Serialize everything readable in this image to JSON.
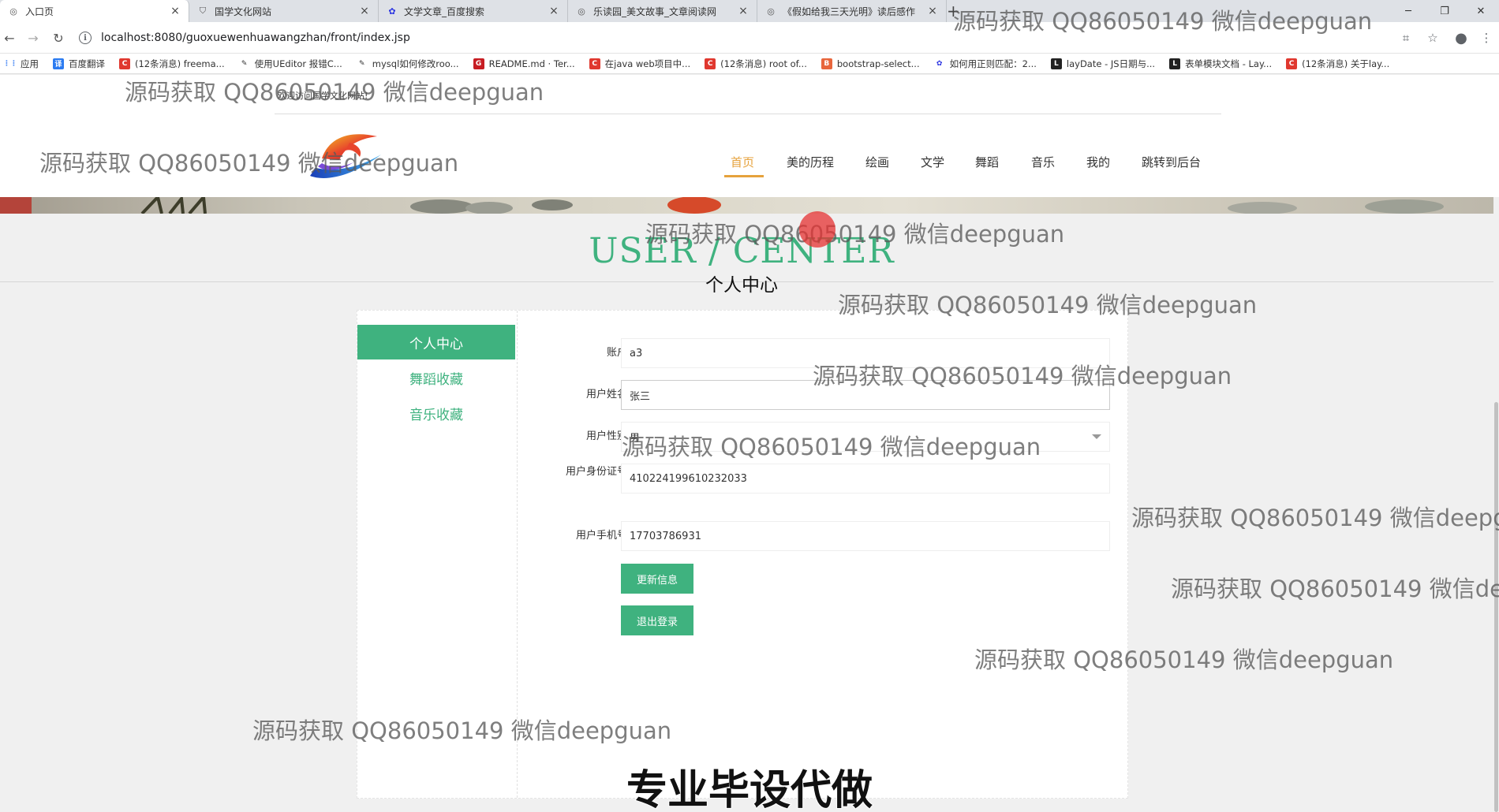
{
  "browser": {
    "tabs": [
      {
        "title": "入口页",
        "icon": "globe-icon",
        "active": true
      },
      {
        "title": "国学文化网站",
        "icon": "shield-icon",
        "active": false
      },
      {
        "title": "文学文章_百度搜索",
        "icon": "paw-icon",
        "active": false
      },
      {
        "title": "乐读园_美文故事_文章阅读网",
        "icon": "globe-icon",
        "active": false
      },
      {
        "title": "《假如给我三天光明》读后感作",
        "icon": "globe-icon",
        "active": false
      }
    ],
    "url": "localhost:8080/guoxuewenhuawangzhan/front/index.jsp",
    "bookmarks": [
      {
        "label": "应用",
        "icon": "apps-grid-icon",
        "color": "#4285f4"
      },
      {
        "label": "百度翻译",
        "icon": "translate-icon",
        "color": "#2b7bf1"
      },
      {
        "label": "(12条消息) freema...",
        "icon": "csdn-icon",
        "color": "#e0382f"
      },
      {
        "label": "使用UEditor 报错C...",
        "icon": "pen-icon",
        "color": "#333333"
      },
      {
        "label": "mysql如何修改roo...",
        "icon": "pen-icon",
        "color": "#333333"
      },
      {
        "label": "README.md · Ter...",
        "icon": "gitee-icon",
        "color": "#c71d23"
      },
      {
        "label": "在java web项目中...",
        "icon": "csdn-icon",
        "color": "#e0382f"
      },
      {
        "label": "(12条消息) root of...",
        "icon": "csdn-icon",
        "color": "#e0382f"
      },
      {
        "label": "bootstrap-select...",
        "icon": "bootstrap-icon",
        "color": "#e8663c"
      },
      {
        "label": "如何用正则匹配：2...",
        "icon": "paw-icon",
        "color": "#2932e1"
      },
      {
        "label": "layDate - JS日期与...",
        "icon": "layui-icon",
        "color": "#222222"
      },
      {
        "label": "表单模块文档 - Lay...",
        "icon": "layui-icon",
        "color": "#222222"
      },
      {
        "label": "(12条消息) 关于lay...",
        "icon": "csdn-icon",
        "color": "#e0382f"
      }
    ]
  },
  "header": {
    "welcome": "欢迎访问国学文化网站!",
    "nav": [
      {
        "label": "首页",
        "active": true
      },
      {
        "label": "美的历程",
        "active": false
      },
      {
        "label": "绘画",
        "active": false
      },
      {
        "label": "文学",
        "active": false
      },
      {
        "label": "舞蹈",
        "active": false
      },
      {
        "label": "音乐",
        "active": false
      },
      {
        "label": "我的",
        "active": false
      },
      {
        "label": "跳转到后台",
        "active": false
      }
    ]
  },
  "section": {
    "title_en": "USER / CENTER",
    "title_cn": "个人中心"
  },
  "sidebar": {
    "items": [
      {
        "label": "个人中心",
        "active": true
      },
      {
        "label": "舞蹈收藏",
        "active": false
      },
      {
        "label": "音乐收藏",
        "active": false
      }
    ]
  },
  "form": {
    "account": {
      "label": "账户",
      "value": "a3"
    },
    "name": {
      "label": "用户姓名",
      "value": "张三"
    },
    "gender": {
      "label": "用户性别",
      "value": "男"
    },
    "id_card": {
      "label": "用户身份证号",
      "value": "410224199610232033"
    },
    "phone": {
      "label": "用户手机号",
      "value": "17703786931"
    },
    "update_button": "更新信息",
    "logout_button": "退出登录"
  },
  "overlay": {
    "watermark": "源码获取 QQ86050149 微信deepguan",
    "promo": "专业毕设代做"
  },
  "colors": {
    "accent_green": "#3fb27f",
    "nav_active": "#e6a23c"
  }
}
